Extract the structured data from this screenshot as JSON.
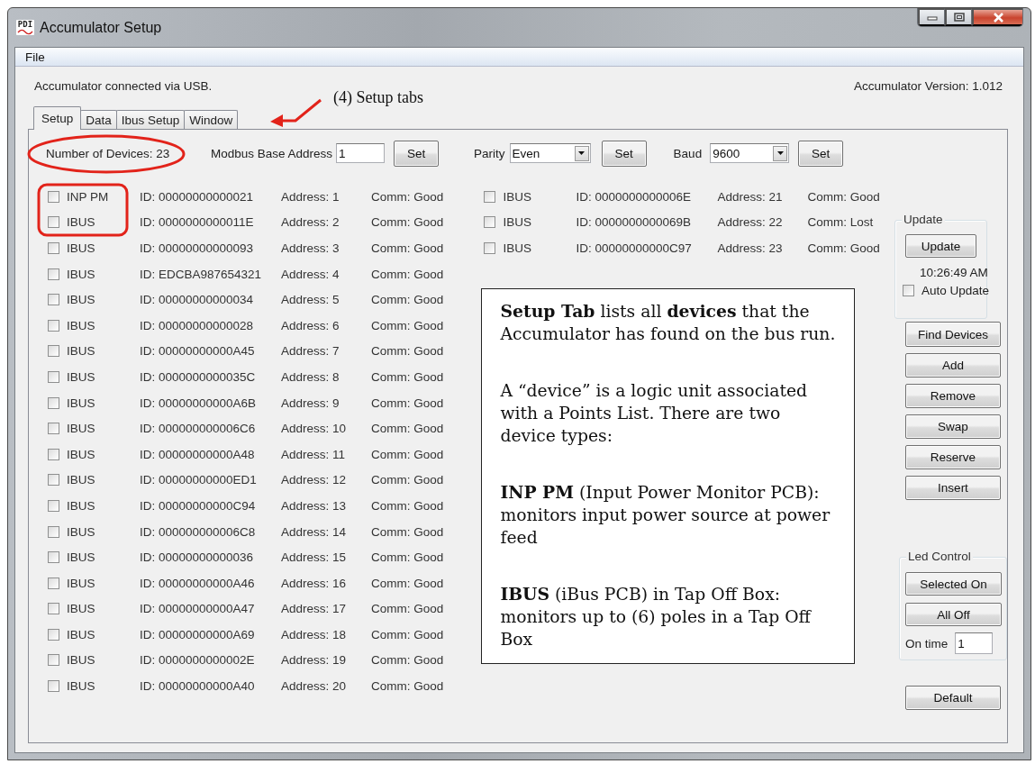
{
  "window": {
    "title": "Accumulator Setup",
    "logo_text": "PDI"
  },
  "menu": [
    {
      "label": "File"
    }
  ],
  "status": "Accumulator connected via USB.",
  "version": "Accumulator Version: 1.012",
  "tabs": [
    {
      "label": "Setup",
      "selected": true
    },
    {
      "label": "Data",
      "selected": false
    },
    {
      "label": "Ibus Setup",
      "selected": false
    },
    {
      "label": "Window",
      "selected": false
    }
  ],
  "device_count": "Number of Devices: 23",
  "settings": [
    {
      "kind": "text",
      "label": "Modbus Base Address",
      "value": "1",
      "button": "Set"
    },
    {
      "kind": "dropdown",
      "label": "Parity",
      "value": "Even",
      "button": "Set"
    },
    {
      "kind": "dropdown",
      "label": "Baud",
      "value": "9600",
      "button": "Set"
    }
  ],
  "devices": [
    {
      "type": "INP PM",
      "id": "ID: 00000000000021",
      "address": "Address: 1",
      "comm": "Comm: Good",
      "checked": false
    },
    {
      "type": "IBUS",
      "id": "ID: 0000000000011E",
      "address": "Address: 2",
      "comm": "Comm: Good",
      "checked": false
    },
    {
      "type": "IBUS",
      "id": "ID: 00000000000093",
      "address": "Address: 3",
      "comm": "Comm: Good",
      "checked": false
    },
    {
      "type": "IBUS",
      "id": "ID: EDCBA987654321",
      "address": "Address: 4",
      "comm": "Comm: Good",
      "checked": false
    },
    {
      "type": "IBUS",
      "id": "ID: 00000000000034",
      "address": "Address: 5",
      "comm": "Comm: Good",
      "checked": false
    },
    {
      "type": "IBUS",
      "id": "ID: 00000000000028",
      "address": "Address: 6",
      "comm": "Comm: Good",
      "checked": false
    },
    {
      "type": "IBUS",
      "id": "ID: 00000000000A45",
      "address": "Address: 7",
      "comm": "Comm: Good",
      "checked": false
    },
    {
      "type": "IBUS",
      "id": "ID: 0000000000035C",
      "address": "Address: 8",
      "comm": "Comm: Good",
      "checked": false
    },
    {
      "type": "IBUS",
      "id": "ID: 00000000000A6B",
      "address": "Address: 9",
      "comm": "Comm: Good",
      "checked": false
    },
    {
      "type": "IBUS",
      "id": "ID: 000000000006C6",
      "address": "Address: 10",
      "comm": "Comm: Good",
      "checked": false
    },
    {
      "type": "IBUS",
      "id": "ID: 00000000000A48",
      "address": "Address: 11",
      "comm": "Comm: Good",
      "checked": false
    },
    {
      "type": "IBUS",
      "id": "ID: 00000000000ED1",
      "address": "Address: 12",
      "comm": "Comm: Good",
      "checked": false
    },
    {
      "type": "IBUS",
      "id": "ID: 00000000000C94",
      "address": "Address: 13",
      "comm": "Comm: Good",
      "checked": false
    },
    {
      "type": "IBUS",
      "id": "ID: 000000000006C8",
      "address": "Address: 14",
      "comm": "Comm: Good",
      "checked": false
    },
    {
      "type": "IBUS",
      "id": "ID: 00000000000036",
      "address": "Address: 15",
      "comm": "Comm: Good",
      "checked": false
    },
    {
      "type": "IBUS",
      "id": "ID: 00000000000A46",
      "address": "Address: 16",
      "comm": "Comm: Good",
      "checked": false
    },
    {
      "type": "IBUS",
      "id": "ID: 00000000000A47",
      "address": "Address: 17",
      "comm": "Comm: Good",
      "checked": false
    },
    {
      "type": "IBUS",
      "id": "ID: 00000000000A69",
      "address": "Address: 18",
      "comm": "Comm: Good",
      "checked": false
    },
    {
      "type": "IBUS",
      "id": "ID: 0000000000002E",
      "address": "Address: 19",
      "comm": "Comm: Good",
      "checked": false
    },
    {
      "type": "IBUS",
      "id": "ID: 00000000000A40",
      "address": "Address: 20",
      "comm": "Comm: Good",
      "checked": false
    },
    {
      "type": "IBUS",
      "id": "ID: 0000000000006E",
      "address": "Address: 21",
      "comm": "Comm: Good",
      "checked": false
    },
    {
      "type": "IBUS",
      "id": "ID: 0000000000069B",
      "address": "Address: 22",
      "comm": "Comm: Lost",
      "checked": false
    },
    {
      "type": "IBUS",
      "id": "ID: 00000000000C97",
      "address": "Address: 23",
      "comm": "Comm: Good",
      "checked": false
    }
  ],
  "update_group": {
    "title": "Update",
    "button": "Update",
    "time": "10:26:49 AM",
    "auto_update": {
      "label": "Auto Update",
      "checked": false
    }
  },
  "actions": [
    "Find Devices",
    "Add",
    "Remove",
    "Swap",
    "Reserve",
    "Insert"
  ],
  "led_control": {
    "title": "Led Control",
    "buttons": [
      "Selected On",
      "All Off"
    ],
    "on_time_label": "On time",
    "on_time_value": "1"
  },
  "default_button": "Default",
  "annotations": {
    "tabs_callout": "(4) Setup tabs",
    "note": [
      "**Setup Tab** lists all **devices** that the Accumulator has found on the bus run.",
      "A “device” is a logic unit associated with a Points List. There are two device types:",
      "**INP PM** (Input Power Monitor PCB): monitors input power source at power feed",
      "**IBUS** (iBus PCB) in Tap Off Box: monitors up to (6) poles in a Tap Off Box"
    ]
  }
}
